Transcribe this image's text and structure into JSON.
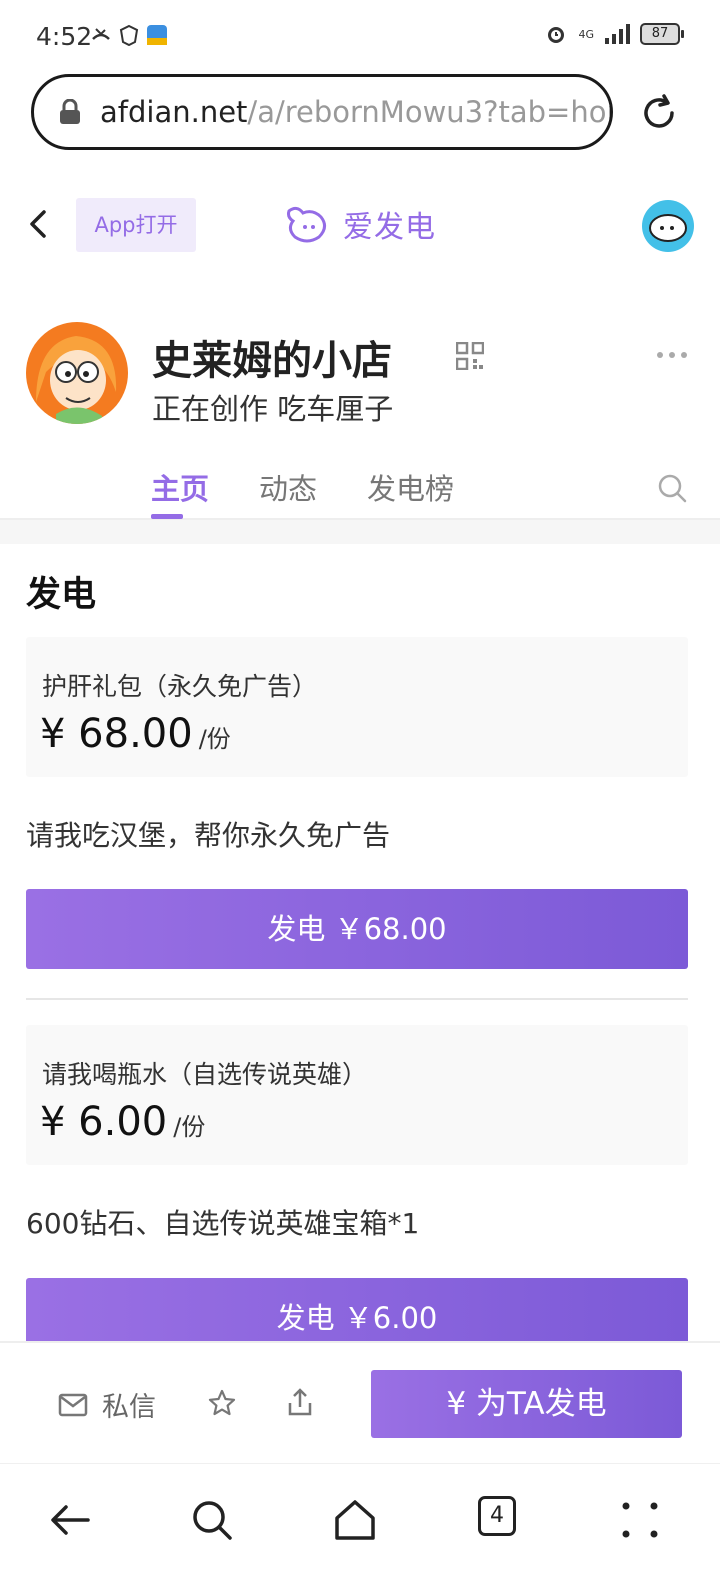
{
  "status_bar": {
    "time": "4:52",
    "network": "4G",
    "battery": "87"
  },
  "browser": {
    "url_host": "afdian.net",
    "url_path": "/a/rebornMowu3?tab=hom"
  },
  "site_nav": {
    "app_open_label": "App打开",
    "brand_name": "爱发电"
  },
  "profile": {
    "name": "史莱姆的小店",
    "subtitle": "正在创作 吃车厘子"
  },
  "tabs": [
    {
      "label": "主页",
      "active": true
    },
    {
      "label": "动态",
      "active": false
    },
    {
      "label": "发电榜",
      "active": false
    }
  ],
  "section_title": "发电",
  "plans": [
    {
      "name": "护肝礼包（永久免广告）",
      "price": "¥ 68.00",
      "unit": "/份",
      "description": "请我吃汉堡，帮你永久免广告",
      "button_label": "发电 ￥68.00"
    },
    {
      "name": "请我喝瓶水（自选传说英雄）",
      "price": "¥ 6.00",
      "unit": "/份",
      "description": "600钻石、自选传说英雄宝箱*1",
      "button_label": "发电 ￥6.00"
    }
  ],
  "action_bar": {
    "message_label": "私信",
    "support_label": "¥  为TA发电"
  },
  "browser_nav": {
    "tab_count": "4"
  },
  "colors": {
    "accent": "#946ce6",
    "button_start": "#9a70e4",
    "button_end": "#7c5ad7"
  }
}
